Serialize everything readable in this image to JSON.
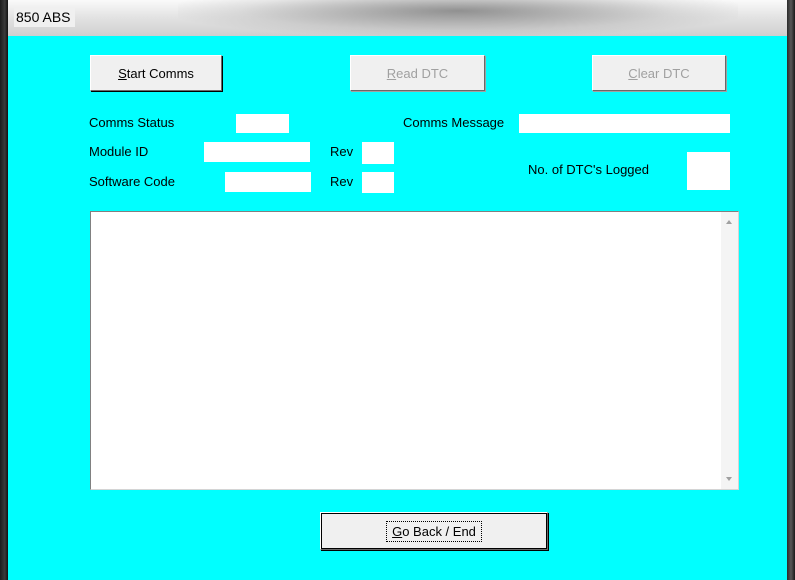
{
  "window": {
    "title": "850 ABS"
  },
  "buttons": {
    "start_comms": {
      "mnemonic": "S",
      "rest": "tart Comms"
    },
    "read_dtc": {
      "mnemonic": "R",
      "rest": "ead DTC"
    },
    "clear_dtc": {
      "mnemonic": "C",
      "rest": "lear DTC"
    },
    "go_back": {
      "mnemonic": "G",
      "rest": "o Back / End"
    }
  },
  "labels": {
    "comms_status": "Comms Status",
    "comms_message": "Comms Message",
    "module_id": "Module ID",
    "rev1": "Rev",
    "software_code": "Software Code",
    "rev2": "Rev",
    "dtc_logged": "No. of DTC's Logged"
  },
  "fields": {
    "comms_status": "",
    "comms_message": "",
    "module_id": "",
    "module_rev": "",
    "software_code": "",
    "software_rev": "",
    "dtc_count": "",
    "output": ""
  }
}
